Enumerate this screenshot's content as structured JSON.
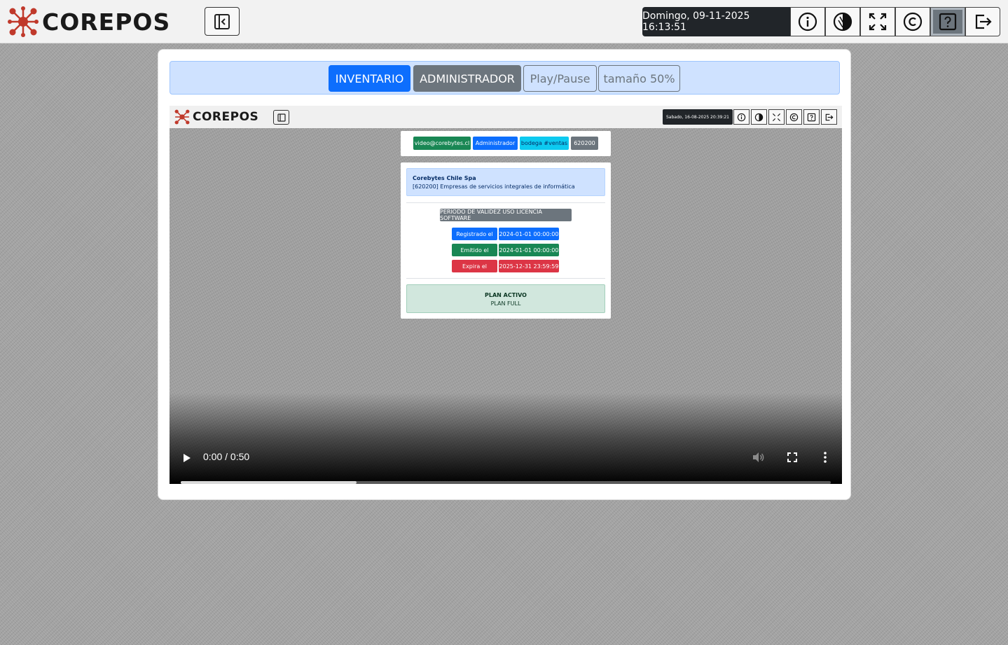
{
  "app": {
    "name": "COREPOS"
  },
  "header": {
    "clock": "Domingo, 09-11-2025 16:13:51",
    "icons": [
      "info-icon",
      "contrast-icon",
      "fullscreen-icon",
      "copyright-icon",
      "help-icon",
      "logout-icon"
    ],
    "active_icon": "help-icon"
  },
  "toolbar": {
    "inventory_label": "INVENTARIO",
    "admin_label": "ADMINISTRADOR",
    "playpause_label": "Play/Pause",
    "size_label": "tamaño 50%"
  },
  "video": {
    "inner_app_name": "COREPOS",
    "inner_clock": "Sabado, 16-08-2025 20:39:21",
    "badges": {
      "email": "video@corebytes.cl",
      "role": "Administrador",
      "warehouse": "bodega #ventas",
      "code": "620200"
    },
    "company": {
      "name": "Corebytes Chile Spa",
      "description": "[620200] Empresas de servicios integrales de informática"
    },
    "license": {
      "title": "PERIODO DE VALIDEZ USO LICENCIA SOFTWARE",
      "rows": [
        {
          "label": "Registrado el",
          "value": "2024-01-01 00:00:00"
        },
        {
          "label": "Emitido el",
          "value": "2024-01-01 00:00:00"
        },
        {
          "label": "Expira el",
          "value": "2025-12-31 23:59:59"
        }
      ]
    },
    "plan": {
      "title": "PLAN ACTIVO",
      "value": "PLAN FULL"
    },
    "player": {
      "time": "0:00 / 0:50",
      "buffered_fraction": 0.27
    }
  },
  "colors": {
    "primary": "#0d6efd",
    "secondary": "#6c757d",
    "success": "#198754",
    "danger": "#dc3545",
    "info": "#0dcaf0",
    "logo_accent": "#c0392b"
  }
}
